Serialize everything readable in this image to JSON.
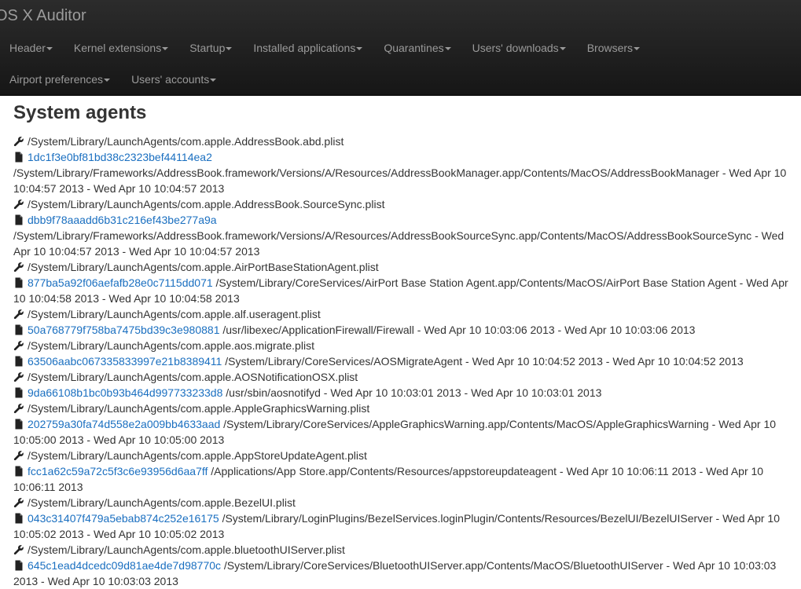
{
  "app": {
    "brand": "OS X Auditor"
  },
  "nav": {
    "row1": [
      "Header",
      "Kernel extensions",
      "Startup",
      "Installed applications",
      "Quarantines",
      "Users' downloads",
      "Browsers"
    ],
    "row2": [
      "Airport preferences",
      "Users' accounts"
    ]
  },
  "section": {
    "title": "System agents"
  },
  "entries": [
    {
      "plist": "/System/Library/LaunchAgents/com.apple.AddressBook.abd.plist",
      "hash": "1dc1f3e0bf81bd38c2323bef44114ea2",
      "detail": "/System/Library/Frameworks/AddressBook.framework/Versions/A/Resources/AddressBookManager.app/Contents/MacOS/AddressBookManager - Wed Apr 10 10:04:57 2013 - Wed Apr 10 10:04:57 2013"
    },
    {
      "plist": "/System/Library/LaunchAgents/com.apple.AddressBook.SourceSync.plist",
      "hash": "dbb9f78aaadd6b31c216ef43be277a9a",
      "detail": "/System/Library/Frameworks/AddressBook.framework/Versions/A/Resources/AddressBookSourceSync.app/Contents/MacOS/AddressBookSourceSync - Wed Apr 10 10:04:57 2013 - Wed Apr 10 10:04:57 2013"
    },
    {
      "plist": "/System/Library/LaunchAgents/com.apple.AirPortBaseStationAgent.plist",
      "hash": "877ba5a92f06aefafb28e0c7115dd071",
      "detail": "/System/Library/CoreServices/AirPort Base Station Agent.app/Contents/MacOS/AirPort Base Station Agent - Wed Apr 10 10:04:58 2013 - Wed Apr 10 10:04:58 2013"
    },
    {
      "plist": "/System/Library/LaunchAgents/com.apple.alf.useragent.plist",
      "hash": "50a768779f758ba7475bd39c3e980881",
      "detail": "/usr/libexec/ApplicationFirewall/Firewall - Wed Apr 10 10:03:06 2013 - Wed Apr 10 10:03:06 2013"
    },
    {
      "plist": "/System/Library/LaunchAgents/com.apple.aos.migrate.plist",
      "hash": "63506aabc067335833997e21b8389411",
      "detail": "/System/Library/CoreServices/AOSMigrateAgent - Wed Apr 10 10:04:52 2013 - Wed Apr 10 10:04:52 2013"
    },
    {
      "plist": "/System/Library/LaunchAgents/com.apple.AOSNotificationOSX.plist",
      "hash": "9da66108b1bc0b93b464d997733233d8",
      "detail": "/usr/sbin/aosnotifyd - Wed Apr 10 10:03:01 2013 - Wed Apr 10 10:03:01 2013"
    },
    {
      "plist": "/System/Library/LaunchAgents/com.apple.AppleGraphicsWarning.plist",
      "hash": "202759a30fa74d558e2a009bb4633aad",
      "detail": "/System/Library/CoreServices/AppleGraphicsWarning.app/Contents/MacOS/AppleGraphicsWarning - Wed Apr 10 10:05:00 2013 - Wed Apr 10 10:05:00 2013"
    },
    {
      "plist": "/System/Library/LaunchAgents/com.apple.AppStoreUpdateAgent.plist",
      "hash": "fcc1a62c59a72c5f3c6e93956d6aa7ff",
      "detail": "/Applications/App Store.app/Contents/Resources/appstoreupdateagent - Wed Apr 10 10:06:11 2013 - Wed Apr 10 10:06:11 2013"
    },
    {
      "plist": "/System/Library/LaunchAgents/com.apple.BezelUI.plist",
      "hash": "043c31407f479a5ebab874c252e16175",
      "detail": "/System/Library/LoginPlugins/BezelServices.loginPlugin/Contents/Resources/BezelUI/BezelUIServer - Wed Apr 10 10:05:02 2013 - Wed Apr 10 10:05:02 2013"
    },
    {
      "plist": "/System/Library/LaunchAgents/com.apple.bluetoothUIServer.plist",
      "hash": "645c1ead4dcedc09d81ae4de7d98770c",
      "detail": "/System/Library/CoreServices/BluetoothUIServer.app/Contents/MacOS/BluetoothUIServer - Wed Apr 10 10:03:03 2013 - Wed Apr 10 10:03:03 2013"
    }
  ]
}
